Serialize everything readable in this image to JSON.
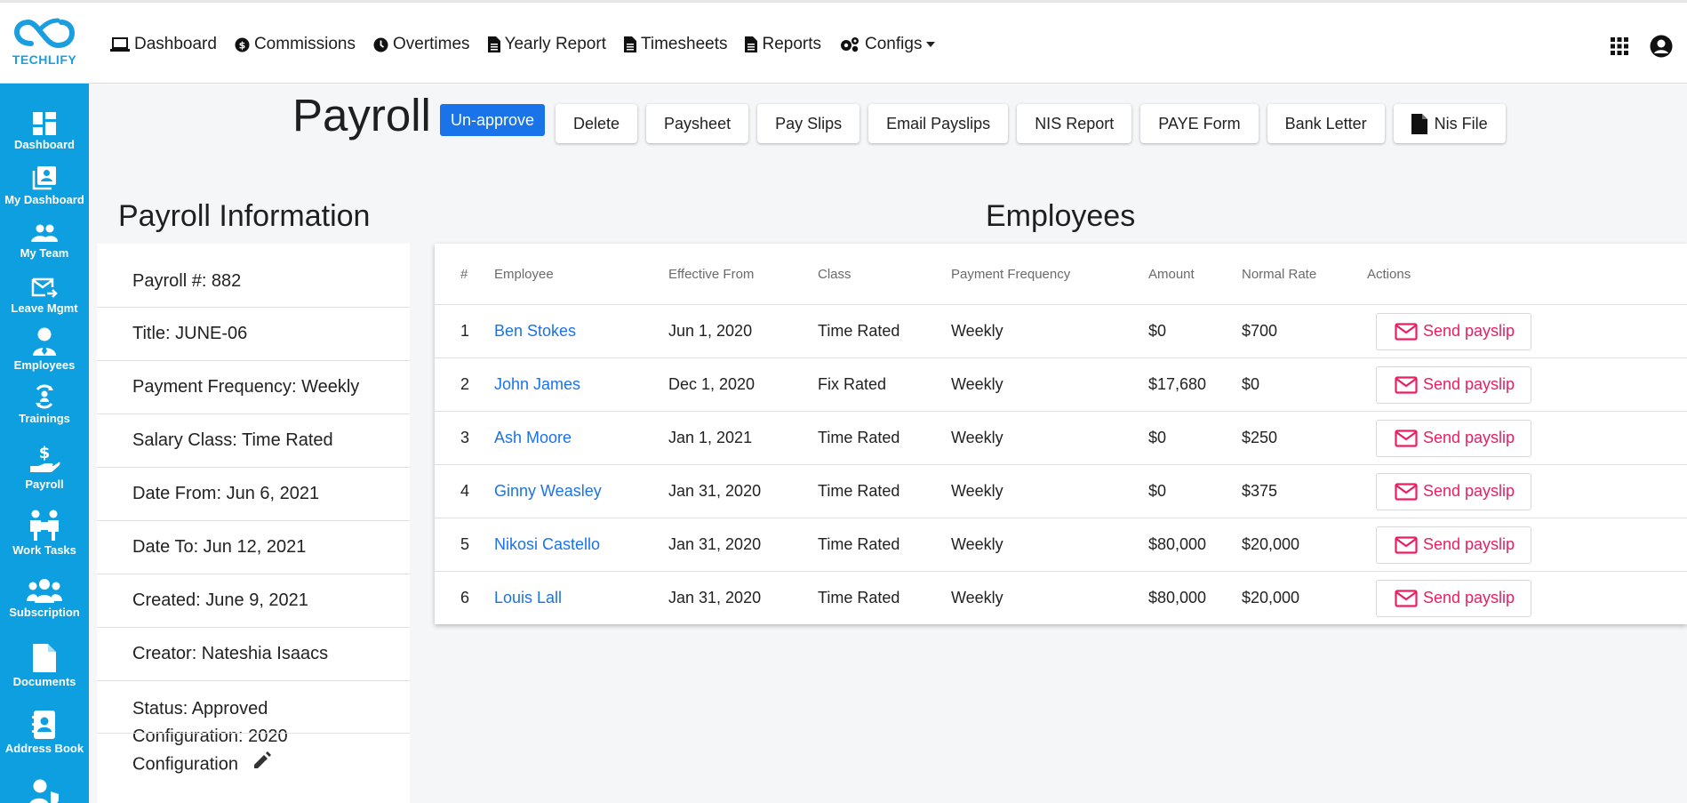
{
  "brand": {
    "name": "TECHLIFY"
  },
  "nav": {
    "items": [
      {
        "label": "Dashboard",
        "icon": "laptop-icon"
      },
      {
        "label": "Commissions",
        "icon": "money-circle-icon"
      },
      {
        "label": "Overtimes",
        "icon": "clock-icon"
      },
      {
        "label": "Yearly Report",
        "icon": "document-icon"
      },
      {
        "label": "Timesheets",
        "icon": "document-icon"
      },
      {
        "label": "Reports",
        "icon": "document-icon"
      },
      {
        "label": "Configs",
        "icon": "gears-icon"
      }
    ]
  },
  "sidebar": {
    "items": [
      {
        "label": "Dashboard",
        "icon": "dashboard-icon"
      },
      {
        "label": "My Dashboard",
        "icon": "my-dashboard-icon"
      },
      {
        "label": "My Team",
        "icon": "team-icon"
      },
      {
        "label": "Leave Mgmt",
        "icon": "mail-forward-icon"
      },
      {
        "label": "Employees",
        "icon": "employee-icon"
      },
      {
        "label": "Trainings",
        "icon": "trainings-icon"
      },
      {
        "label": "Payroll",
        "icon": "payroll-hand-icon"
      },
      {
        "label": "Work Tasks",
        "icon": "work-tasks-icon"
      },
      {
        "label": "Subscription",
        "icon": "group-icon"
      },
      {
        "label": "Documents",
        "icon": "file-icon"
      },
      {
        "label": "Address Book",
        "icon": "address-book-icon"
      }
    ]
  },
  "page": {
    "title": "Payroll",
    "primary_action": "Un-approve",
    "actions": [
      "Delete",
      "Paysheet",
      "Pay Slips",
      "Email Payslips",
      "NIS Report",
      "PAYE Form",
      "Bank Letter",
      "Nis File"
    ]
  },
  "info": {
    "heading": "Payroll Information",
    "rows": [
      "Payroll #: 882",
      "Title: JUNE-06",
      "Payment Frequency: Weekly",
      "Salary Class: Time Rated",
      "Date From: Jun 6, 2021",
      "Date To: Jun 12, 2021",
      "Created: June 9, 2021",
      "Creator: Nateshia Isaacs"
    ],
    "status": "Status: Approved",
    "configuration_line1": "Configuration: 2020",
    "configuration_line2": "Configuration"
  },
  "employees": {
    "heading": "Employees",
    "columns": [
      "#",
      "Employee",
      "Effective From",
      "Class",
      "Payment Frequency",
      "Amount",
      "Normal Rate",
      "Actions"
    ],
    "action_label": "Send payslip",
    "rows": [
      {
        "num": "1",
        "name": "Ben Stokes",
        "effective": "Jun 1, 2020",
        "class": "Time Rated",
        "frequency": "Weekly",
        "amount": "$0",
        "rate": "$700"
      },
      {
        "num": "2",
        "name": "John James",
        "effective": "Dec 1, 2020",
        "class": "Fix Rated",
        "frequency": "Weekly",
        "amount": "$17,680",
        "rate": "$0"
      },
      {
        "num": "3",
        "name": "Ash Moore",
        "effective": "Jan 1, 2021",
        "class": "Time Rated",
        "frequency": "Weekly",
        "amount": "$0",
        "rate": "$250"
      },
      {
        "num": "4",
        "name": "Ginny Weasley",
        "effective": "Jan 31, 2020",
        "class": "Time Rated",
        "frequency": "Weekly",
        "amount": "$0",
        "rate": "$375"
      },
      {
        "num": "5",
        "name": "Nikosi Castello",
        "effective": "Jan 31, 2020",
        "class": "Time Rated",
        "frequency": "Weekly",
        "amount": "$80,000",
        "rate": "$20,000"
      },
      {
        "num": "6",
        "name": "Louis Lall",
        "effective": "Jan 31, 2020",
        "class": "Time Rated",
        "frequency": "Weekly",
        "amount": "$80,000",
        "rate": "$20,000"
      }
    ]
  },
  "colors": {
    "sidebar": "#0d9fe0",
    "primary": "#1a73e8",
    "link": "#1a73e8",
    "send_payslip": "#e91e63"
  }
}
